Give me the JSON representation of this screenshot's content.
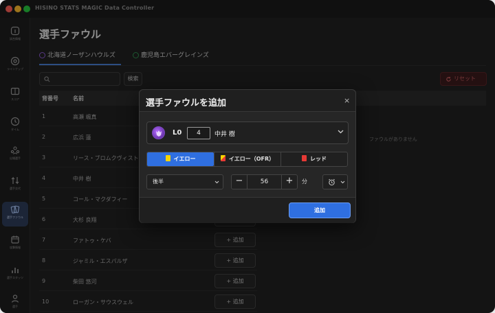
{
  "window": {
    "title": "HISINO STATS MAGIC Data Controller"
  },
  "sidebar": {
    "items": [
      {
        "label": "試合情報",
        "icon": "info-icon"
      },
      {
        "label": "ラインナップ",
        "icon": "lineup-icon"
      },
      {
        "label": "スコア",
        "icon": "score-icon"
      },
      {
        "label": "タイム",
        "icon": "clock-icon"
      },
      {
        "label": "出場選手",
        "icon": "players-icon"
      },
      {
        "label": "選手交代",
        "icon": "substitution-icon"
      },
      {
        "label": "選手ファウル",
        "icon": "foul-icon",
        "active": true
      },
      {
        "label": "攻撃情報",
        "icon": "calendar-icon"
      },
      {
        "label": "選手スタッツ",
        "icon": "stats-icon"
      },
      {
        "label": "選手",
        "icon": "person-icon"
      }
    ]
  },
  "page": {
    "title": "選手ファウル"
  },
  "tabs": [
    {
      "label": "北海道ノーザンハウルズ",
      "color": "#8e5bd6",
      "active": true
    },
    {
      "label": "鹿児島エバーグレインズ",
      "color": "#2f8f4e",
      "active": false
    }
  ],
  "toolbar": {
    "search_placeholder": "",
    "search_label": "検索",
    "reset_label": "リセット"
  },
  "table": {
    "headers": {
      "number": "背番号",
      "name": "名前"
    },
    "rows": [
      {
        "number": "1",
        "name": "高瀬 颯真"
      },
      {
        "number": "2",
        "name": "広浜 蓮"
      },
      {
        "number": "3",
        "name": "リース・ブロムクヴィスト"
      },
      {
        "number": "4",
        "name": "中井 樹"
      },
      {
        "number": "5",
        "name": "コール・マクダフィー"
      },
      {
        "number": "6",
        "name": "大杉 良翔"
      },
      {
        "number": "7",
        "name": "ファトゥ・ケバ"
      },
      {
        "number": "8",
        "name": "ジャミル・エスパルザ"
      },
      {
        "number": "9",
        "name": "柴田 悠河"
      },
      {
        "number": "10",
        "name": "ローガン・サウスウェル"
      }
    ],
    "add_label": "+ 追加",
    "empty_text": "ファウルがありません"
  },
  "modal": {
    "title": "選手ファウルを追加",
    "close_glyph": "×",
    "player": {
      "position": "L0",
      "number": "4",
      "name": "中井 樹"
    },
    "card_types": [
      {
        "label": "イエロー",
        "color": "#f5d400",
        "active": true
      },
      {
        "label": "イエロー（OFR）",
        "color": "#e53935",
        "active": false
      },
      {
        "label": "レッド",
        "color": "#e53935",
        "active": false
      }
    ],
    "half": "後半",
    "stepper": {
      "minus": "−",
      "value": "56",
      "plus": "+"
    },
    "unit": "分",
    "submit_label": "追加"
  }
}
